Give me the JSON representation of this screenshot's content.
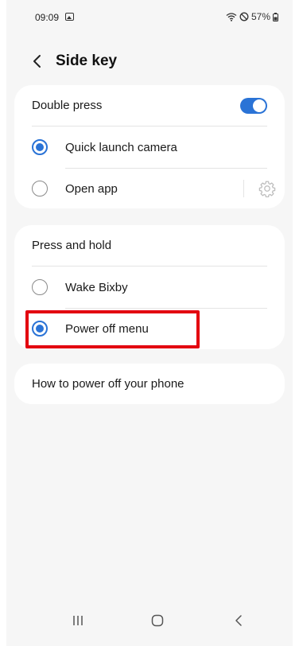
{
  "status_bar": {
    "time": "09:09",
    "battery": "57%"
  },
  "header": {
    "title": "Side key"
  },
  "double_press": {
    "label": "Double press",
    "toggle_on": true,
    "options": [
      {
        "label": "Quick launch camera",
        "selected": true
      },
      {
        "label": "Open app",
        "selected": false
      }
    ]
  },
  "press_and_hold": {
    "label": "Press and hold",
    "options": [
      {
        "label": "Wake Bixby",
        "selected": false
      },
      {
        "label": "Power off menu",
        "selected": true
      }
    ]
  },
  "help_link": {
    "label": "How to power off your phone"
  },
  "colors": {
    "accent": "#2a73d6",
    "highlight": "#e3000f",
    "background": "#f6f6f6"
  },
  "icons": [
    "back-arrow-icon",
    "gear-icon",
    "wifi-icon",
    "do-not-disturb-icon",
    "battery-icon",
    "recent-apps-icon",
    "home-icon",
    "nav-back-icon"
  ]
}
